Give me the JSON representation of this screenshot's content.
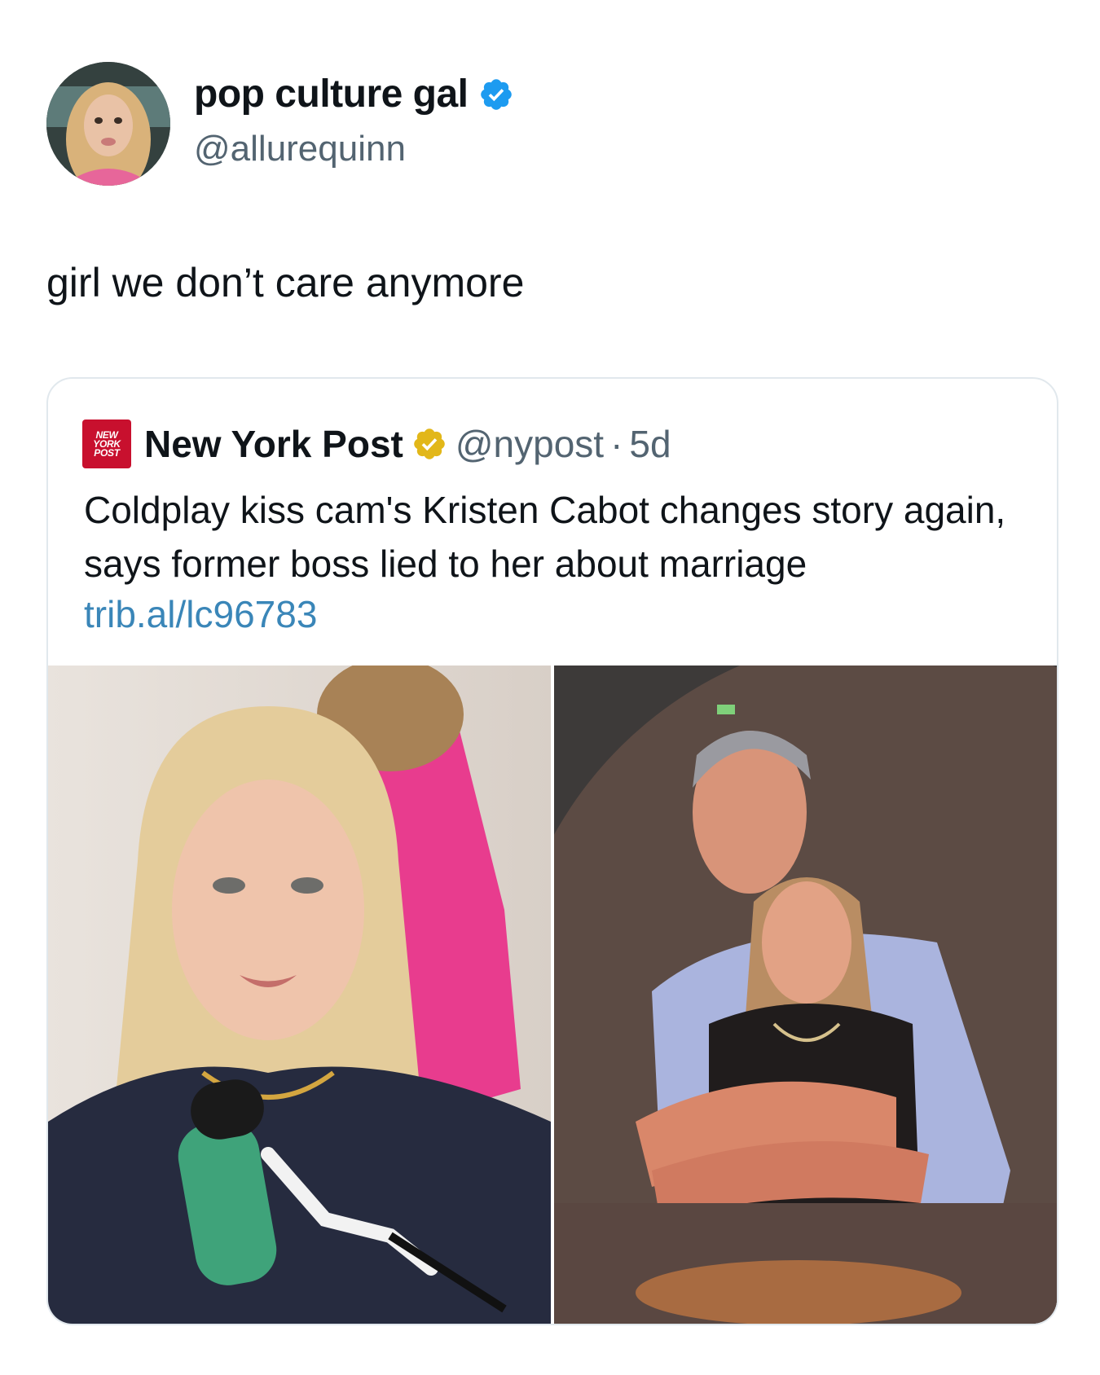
{
  "tweet": {
    "author": {
      "display_name": "pop culture gal",
      "handle": "@allurequinn",
      "verified": true,
      "avatar_icon": "profile-photo"
    },
    "text": "girl we don’t care anymore"
  },
  "quoted_tweet": {
    "author": {
      "logo_lines": [
        "NEW",
        "YORK",
        "POST"
      ],
      "display_name": "New York Post",
      "handle": "@nypost",
      "separator": "·",
      "time": "5d",
      "verified": "gold"
    },
    "headline": "Coldplay kiss cam's Kristen Cabot changes story again, says former boss lied to her about marriage",
    "link": "trib.al/lc96783",
    "images": [
      {
        "name": "podcast-interview-photo"
      },
      {
        "name": "kiss-cam-photo"
      }
    ]
  },
  "colors": {
    "verified_blue": "#1d9bf0",
    "verified_gold": "#e2b719",
    "link": "#3a86b8",
    "secondary_text": "#536471",
    "nypost_red": "#c8102e"
  }
}
